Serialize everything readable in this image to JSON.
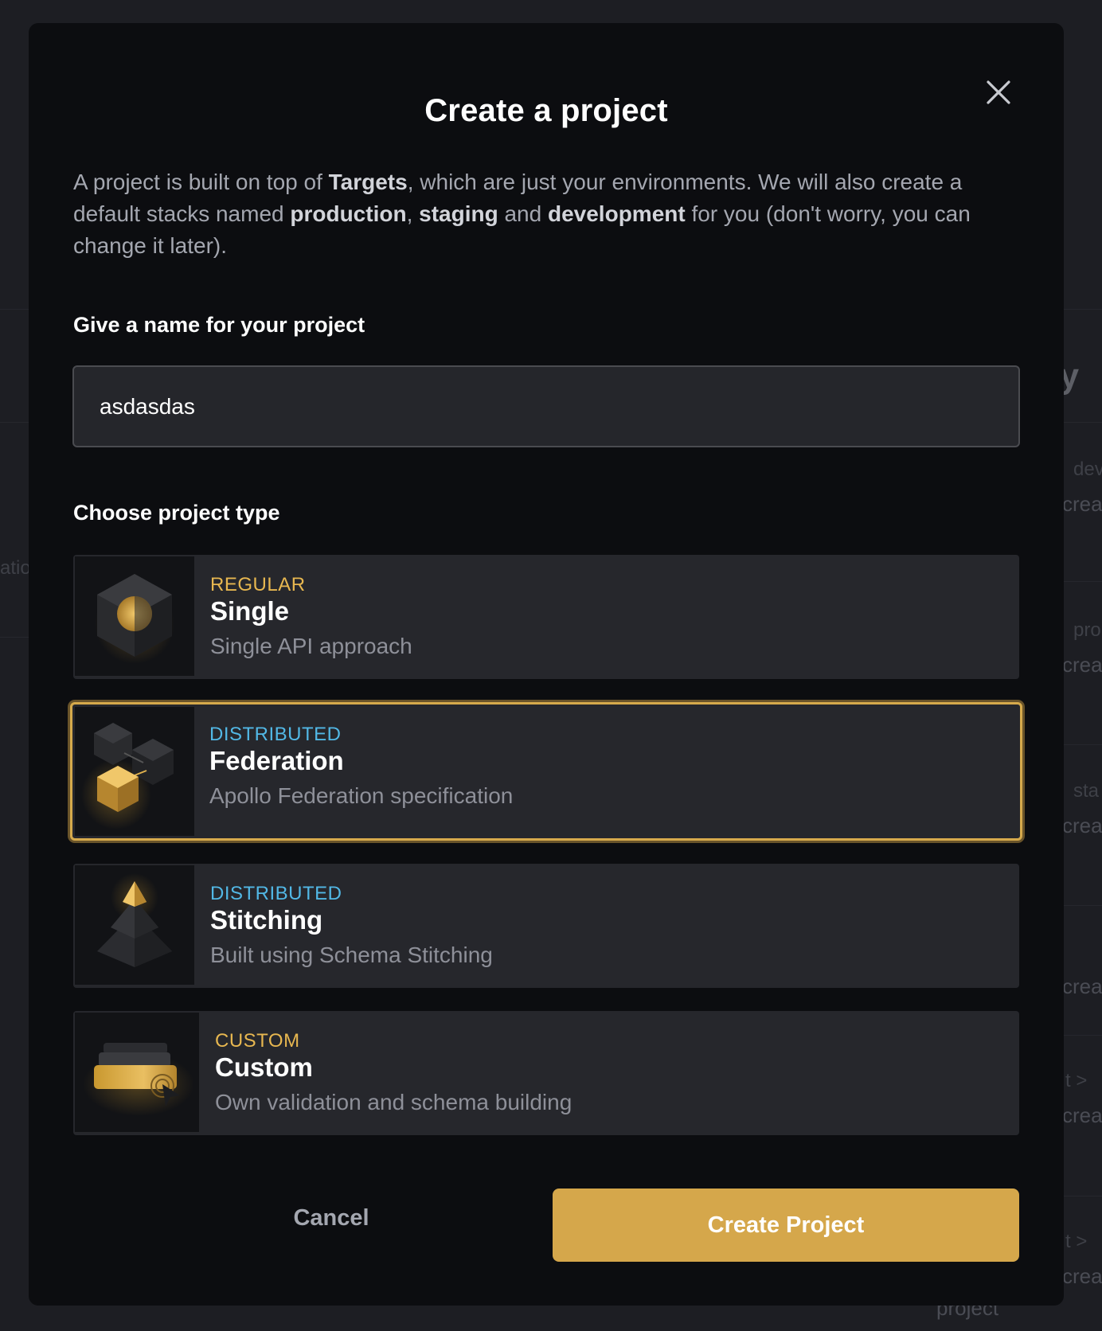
{
  "background": {
    "fragments": [
      "atio",
      "ty",
      "dev",
      "crea",
      "pro",
      "crea",
      "sta",
      "crea",
      "crea",
      "t >",
      "crea",
      "t >",
      "crea",
      "project"
    ]
  },
  "modal": {
    "title": "Create a project",
    "intro": [
      {
        "text": "A project is built on top of ",
        "bold": false
      },
      {
        "text": "Targets",
        "bold": true
      },
      {
        "text": ", which are just your environments. We will also create a default stacks named ",
        "bold": false
      },
      {
        "text": "production",
        "bold": true
      },
      {
        "text": ", ",
        "bold": false
      },
      {
        "text": "staging",
        "bold": true
      },
      {
        "text": " and ",
        "bold": false
      },
      {
        "text": "development",
        "bold": true
      },
      {
        "text": " for you (don't worry, you can change it later).",
        "bold": false
      }
    ],
    "name_label": "Give a name for your project",
    "name_value": "asdasdas",
    "type_label": "Choose project type",
    "types": [
      {
        "tag": "REGULAR",
        "tag_color": "gold",
        "name": "Single",
        "desc": "Single API approach",
        "selected": false,
        "icon": "single-cube-icon"
      },
      {
        "tag": "DISTRIBUTED",
        "tag_color": "blue",
        "name": "Federation",
        "desc": "Apollo Federation specification",
        "selected": true,
        "icon": "federation-cubes-icon"
      },
      {
        "tag": "DISTRIBUTED",
        "tag_color": "blue",
        "name": "Stitching",
        "desc": "Built using Schema Stitching",
        "selected": false,
        "icon": "stitching-pyramid-icon"
      },
      {
        "tag": "CUSTOM",
        "tag_color": "gold",
        "name": "Custom",
        "desc": "Own validation and schema building",
        "selected": false,
        "icon": "custom-stack-icon"
      }
    ],
    "cancel_label": "Cancel",
    "create_label": "Create Project"
  },
  "colors": {
    "accent": "#d5a74b",
    "tag_gold": "#e7b750",
    "tag_blue": "#52b8e6",
    "modal_bg": "#0c0d10",
    "card_bg": "#26272c"
  }
}
